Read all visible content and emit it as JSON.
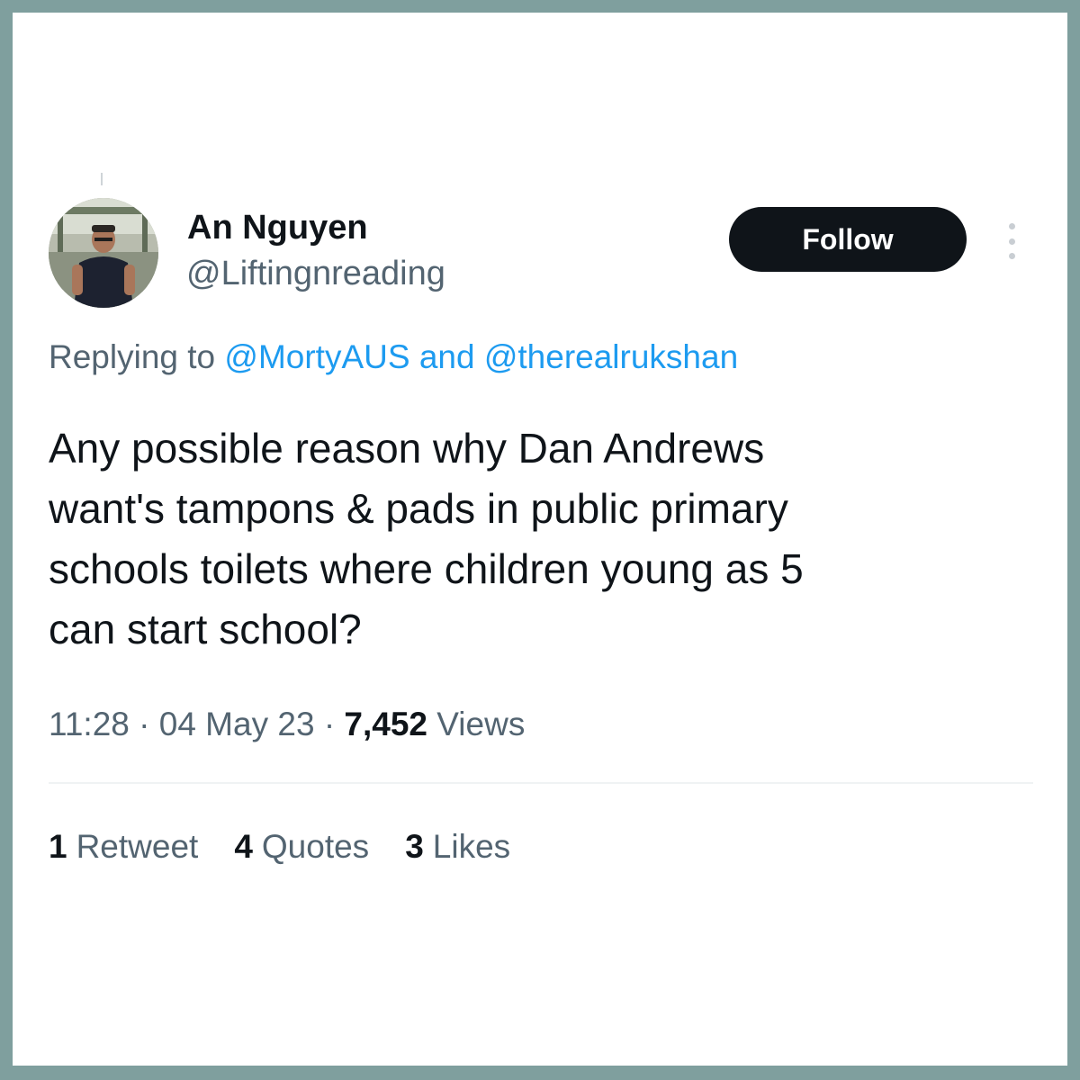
{
  "author": {
    "name": "An Nguyen",
    "handle": "@Liftingnreading"
  },
  "follow_label": "Follow",
  "reply": {
    "prefix": "Replying to",
    "mention_1": "@MortyAUS",
    "joiner": "and",
    "mention_2": "@therealrukshan"
  },
  "tweet": {
    "lines": [
      "Any possible reason why Dan Andrews",
      "want's tampons & pads in public primary",
      "schools toilets where children young as 5",
      "can start school?"
    ]
  },
  "meta": {
    "time": "11:28",
    "separator": "·",
    "date": "04 May 23",
    "views_count": "7,452",
    "views_label": "Views"
  },
  "stats": {
    "retweets_count": "1",
    "retweets_label": "Retweet",
    "quotes_count": "4",
    "quotes_label": "Quotes",
    "likes_count": "3",
    "likes_label": "Likes"
  },
  "colors": {
    "frame": "#7f9f9e",
    "text": "#0f1419",
    "secondary": "#536471",
    "link": "#1d9bf0",
    "button": "#0f1419"
  }
}
